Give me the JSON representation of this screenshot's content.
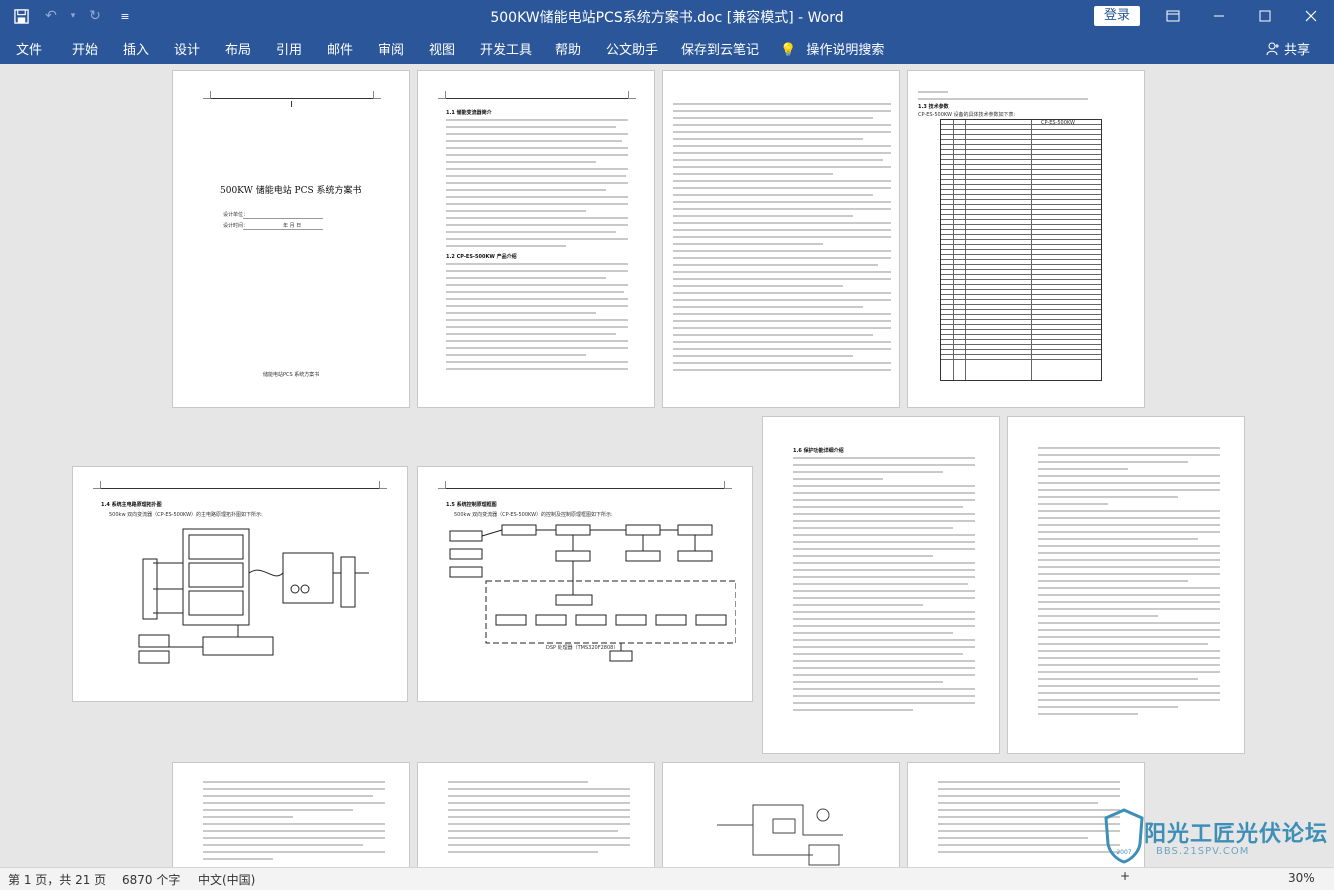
{
  "window": {
    "title": "500KW储能电站PCS系统方案书.doc [兼容模式] - Word",
    "login_label": "登录",
    "minimize_icon": "minimize-icon",
    "restore_icon": "restore-icon",
    "close_icon": "close-icon"
  },
  "quick_access": {
    "save_icon": "save-icon",
    "undo_icon": "undo-icon",
    "redo_icon": "redo-icon",
    "customize_icon": "customize-icon"
  },
  "ribbon": {
    "tabs": [
      "文件",
      "开始",
      "插入",
      "设计",
      "布局",
      "引用",
      "邮件",
      "审阅",
      "视图",
      "开发工具",
      "帮助",
      "公文助手",
      "保存到云笔记"
    ],
    "tell_me": "操作说明搜索",
    "share": "共享"
  },
  "document": {
    "cover_title": "500KW 储能电站 PCS 系统方案书",
    "cover_footer": "储能电站PCS 系统方案书",
    "cover_fields": [
      "设计单位：",
      "设计时间："
    ],
    "cover_date_value": "年  月  日",
    "section_1_1": "1.1 储能变流器简介",
    "section_1_2": "1.2 CP-ES-500KW 产品介绍",
    "section_1_3": "1.3 技术参数",
    "table_caption": "CP-ES-500KW 设备的具体技术参数如下表:",
    "table_model": "CP-ES-500KW",
    "section_1_4": "1.4 系统主电路原理拓扑图",
    "section_1_4_sub": "500kw 双向变流器（CP-ES-500KW）的主电路原理拓扑图如下所示:",
    "section_1_5": "1.5 系统控制原理框图",
    "section_1_5_sub": "500kw 双向变流器（CP-ES-500KW）的控制及控制原理框图如下所示:",
    "section_1_6": "1.6 保护功能详细介绍",
    "diagram_footer": "DSP 处理器（TMS320F2808）"
  },
  "watermark": {
    "text": "阳光工匠光伏论坛",
    "url": "BBS.21SPV.COM",
    "year": "2007"
  },
  "status": {
    "page_info": "第 1 页，共 21 页",
    "word_count": "6870 个字",
    "language": "中文(中国)",
    "zoom": "30%"
  },
  "colors": {
    "ribbon": "#2b579a",
    "workspace": "#e6e6e6",
    "watermark": "#3d8fb8"
  }
}
